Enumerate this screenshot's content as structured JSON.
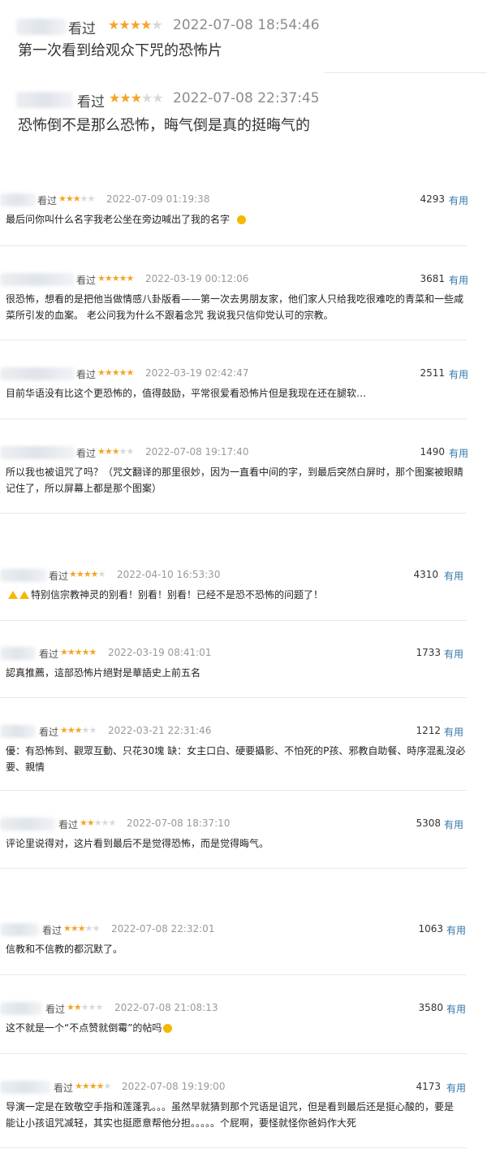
{
  "top_reviews": [
    {
      "status": "看过",
      "rating": 4,
      "date": "2022-07-08 18:54:46",
      "text": "第一次看到给观众下咒的恐怖片"
    },
    {
      "status": "看过",
      "rating": 3,
      "date": "2022-07-08 22:37:45",
      "text": "恐怖倒不是那么恐怖，晦气倒是真的挺晦气的"
    }
  ],
  "comments": [
    {
      "status": "看过",
      "rating": 3,
      "date": "2022-07-09 01:19:38",
      "votes": "4293",
      "useful": "有用",
      "lines": [
        "最后问你叫什么名字我老公坐在旁边喊出了我的名字"
      ]
    },
    {
      "status": "看过",
      "rating": 5,
      "date": "2022-03-19 00:12:06",
      "votes": "3681",
      "useful": "有用",
      "lines": [
        "很恐怖，想看的是把他当做情感八卦版看——第一次去男朋友家，他们家人只给我吃很难吃的青菜和一些咸",
        "菜所引发的血案。 老公问我为什么不跟着念咒 我说我只信仰党认可的宗教。"
      ]
    },
    {
      "status": "看过",
      "rating": 5,
      "date": "2022-03-19 02:42:47",
      "votes": "2511",
      "useful": "有用",
      "lines": [
        "目前华语没有比这个更恐怖的，值得鼓励，平常很爱看恐怖片但是我现在还在腿软…"
      ]
    },
    {
      "status": "看过",
      "rating": 3,
      "date": "2022-07-08 19:17:40",
      "votes": "1490",
      "useful": "有用",
      "lines": [
        "所以我也被诅咒了吗？（咒文翻译的那里很妙，因为一直看中间的字，到最后突然白屏时，那个图案被眼睛",
        "记住了，所以屏幕上都是那个图案）"
      ]
    },
    {
      "status": "看过",
      "rating": 4,
      "date": "2022-04-10 16:53:30",
      "votes": "4310",
      "useful": "有用",
      "lines": [
        "特别信宗教神灵的别看！别看！别看！已经不是恐不恐怖的问题了！"
      ]
    },
    {
      "status": "看过",
      "rating": 5,
      "date": "2022-03-19 08:41:01",
      "votes": "1733",
      "useful": "有用",
      "lines": [
        "認真推薦，這部恐怖片絕對是華語史上前五名"
      ]
    },
    {
      "status": "看过",
      "rating": 3,
      "date": "2022-03-21 22:31:46",
      "votes": "1212",
      "useful": "有用",
      "lines": [
        "優：有恐怖到、觀眾互動、只花30塊 缺：女主口白、硬要攝影、不怕死的P孩、邪教自助餐、時序混亂沒必",
        "要、親情"
      ]
    },
    {
      "status": "看过",
      "rating": 2,
      "date": "2022-07-08 18:37:10",
      "votes": "5308",
      "useful": "有用",
      "lines": [
        "评论里说得对，这片看到最后不是觉得恐怖，而是觉得晦气。"
      ]
    },
    {
      "status": "看过",
      "rating": 3,
      "date": "2022-07-08 22:32:01",
      "votes": "1063",
      "useful": "有用",
      "lines": [
        "信教和不信教的都沉默了。"
      ]
    },
    {
      "status": "看过",
      "rating": 2,
      "date": "2022-07-08 21:08:13",
      "votes": "3580",
      "useful": "有用",
      "lines": [
        "这不就是一个“不点赞就倒霉”的帖吗"
      ]
    },
    {
      "status": "看过",
      "rating": 4,
      "date": "2022-07-08 19:19:00",
      "votes": "4173",
      "useful": "有用",
      "lines": [
        "导演一定是在致敬空手指和莲蓬乳。。。虽然早就猜到那个咒语是诅咒，但是看到最后还是挺心酸的，要是",
        "能让小孩诅咒减轻，其实也挺愿意帮他分担。。。。。个屁啊，要怪就怪你爸妈作大死"
      ]
    }
  ]
}
